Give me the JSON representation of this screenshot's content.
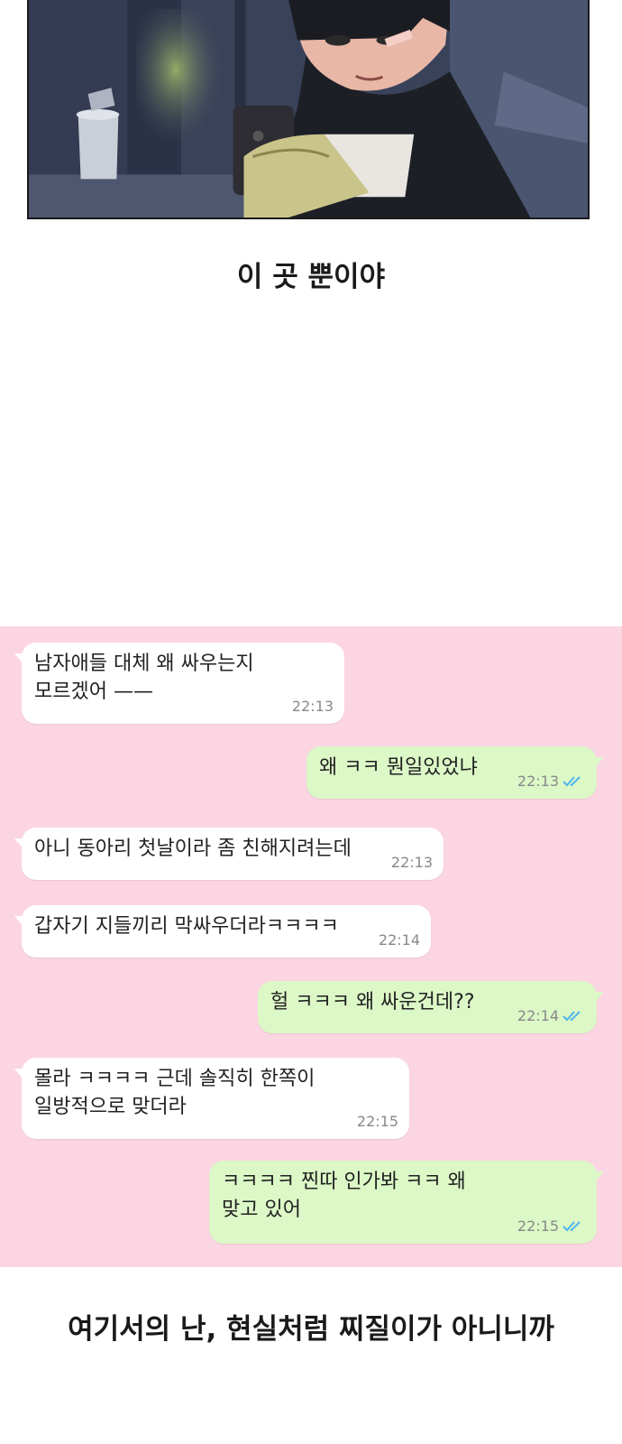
{
  "captions": {
    "top": "이 곳 뿐이야",
    "bottom": "여기서의 난, 현실처럼 찌질이가 아니니까"
  },
  "illustration": {
    "icon": "comic-panel-boy-looking-at-phone-illustration"
  },
  "chat": {
    "background": "#fcd5e3",
    "incoming_color": "#ffffff",
    "outgoing_color": "#dcf8c7",
    "read_tick_color": "#4fb6ec",
    "messages": [
      {
        "direction": "in",
        "text": "남자애들 대체 왜 싸우는지\n모르겠어 ——",
        "time": "22:13"
      },
      {
        "direction": "out",
        "text": "왜 ㅋㅋ 뭔일있었냐",
        "time": "22:13",
        "read": true
      },
      {
        "direction": "in",
        "text": "아니 동아리 첫날이라 좀 친해지려는데",
        "time": "22:13"
      },
      {
        "direction": "in",
        "text": "갑자기 지들끼리 막싸우더라ㅋㅋㅋㅋ",
        "time": "22:14"
      },
      {
        "direction": "out",
        "text": "헐 ㅋㅋㅋ 왜 싸운건데??",
        "time": "22:14",
        "read": true
      },
      {
        "direction": "in",
        "text": "몰라 ㅋㅋㅋㅋ 근데 솔직히 한쪽이\n일방적으로 맞더라",
        "time": "22:15"
      },
      {
        "direction": "out",
        "text": "ㅋㅋㅋㅋ 찐따 인가봐 ㅋㅋ 왜\n맞고 있어",
        "time": "22:15",
        "read": true
      }
    ]
  }
}
